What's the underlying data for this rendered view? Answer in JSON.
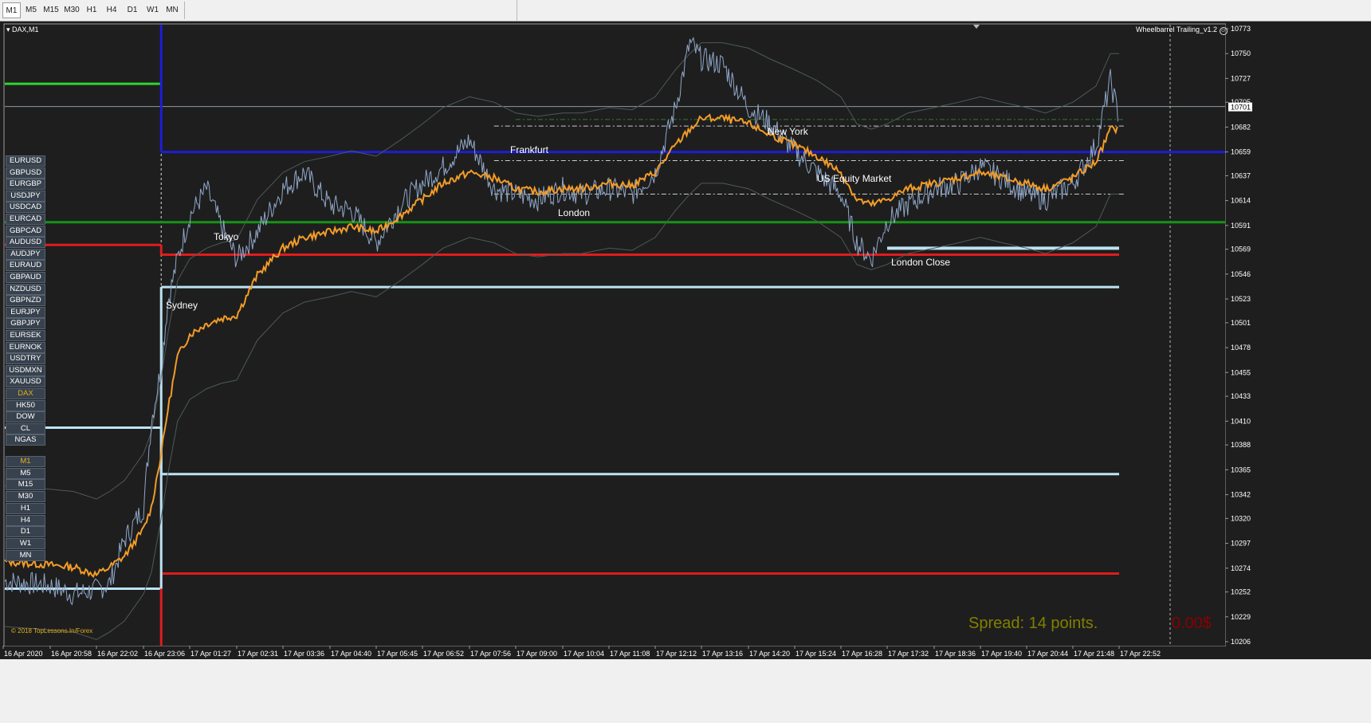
{
  "toolbar": {
    "timeframes": [
      "M1",
      "M5",
      "M15",
      "M30",
      "H1",
      "H4",
      "D1",
      "W1",
      "MN"
    ],
    "active": "M1"
  },
  "chart": {
    "symbol_label": "DAX,M1",
    "indicator_label": "Wheelbarrel Trailing_v1.2",
    "current_price": "10701",
    "copyright": "© 2018 TopLessons.In/Forex",
    "spread_text": "Spread: 14 points.",
    "pl_text": "0.00$",
    "colors": {
      "background": "#1e1e1e",
      "candles": "#8fa7c8",
      "ma_orange": "#f39c28",
      "blue_level": "#1d1dd9",
      "red_level": "#e01c1c",
      "green_level": "#149414",
      "lime_level": "#2fd42f",
      "lightblue_level": "#bde3f3",
      "spread_text": "#808000",
      "pl_text": "#8b0000"
    }
  },
  "symbol_buttons": [
    "EURUSD",
    "GBPUSD",
    "EURGBP",
    "USDJPY",
    "USDCAD",
    "EURCAD",
    "GBPCAD",
    "AUDUSD",
    "AUDJPY",
    "EURAUD",
    "GBPAUD",
    "NZDUSD",
    "GBPNZD",
    "EURJPY",
    "GBPJPY",
    "EURSEK",
    "EURNOK",
    "USDTRY",
    "USDMXN",
    "XAUUSD",
    "DAX",
    "HK50",
    "DOW",
    "CL",
    "NGAS"
  ],
  "selected_symbol": "DAX",
  "timeframe_buttons": [
    "M1",
    "M5",
    "M15",
    "M30",
    "H1",
    "H4",
    "D1",
    "W1",
    "MN"
  ],
  "selected_timeframe": "M1",
  "sessions": [
    "Sydney",
    "Tokyo",
    "Frankfurt",
    "London",
    "New York",
    "US Equity Market",
    "London Close"
  ],
  "chart_data": {
    "type": "line",
    "title": "DAX,M1",
    "price_axis_ticks": [
      "10773",
      "10750",
      "10727",
      "10705",
      "10682",
      "10659",
      "10637",
      "10614",
      "10591",
      "10569",
      "10546",
      "10523",
      "10501",
      "10478",
      "10455",
      "10433",
      "10410",
      "10388",
      "10365",
      "10342",
      "10320",
      "10297",
      "10274",
      "10252",
      "10229",
      "10206"
    ],
    "time_axis_ticks": [
      "16 Apr 2020",
      "16 Apr 20:58",
      "16 Apr 22:02",
      "16 Apr 23:06",
      "17 Apr 01:27",
      "17 Apr 02:31",
      "17 Apr 03:36",
      "17 Apr 04:40",
      "17 Apr 05:45",
      "17 Apr 06:52",
      "17 Apr 07:56",
      "17 Apr 09:00",
      "17 Apr 10:04",
      "17 Apr 11:08",
      "17 Apr 12:12",
      "17 Apr 13:16",
      "17 Apr 14:20",
      "17 Apr 15:24",
      "17 Apr 16:28",
      "17 Apr 17:32",
      "17 Apr 18:36",
      "17 Apr 19:40",
      "17 Apr 20:44",
      "17 Apr 21:48",
      "17 Apr 22:52"
    ],
    "ylim": [
      10206,
      10773
    ],
    "grid": false,
    "levels": [
      {
        "color": "blue",
        "value": 10659,
        "from": "17 Apr 00:00",
        "to": "end"
      },
      {
        "color": "red",
        "value": 10564,
        "from": "17 Apr 00:00",
        "to": "17 Apr 22:52"
      },
      {
        "color": "red",
        "value": 10573,
        "from": "start",
        "to": "17 Apr 00:00"
      },
      {
        "color": "green",
        "value": 10594,
        "from": "start",
        "to": "end"
      },
      {
        "color": "lime",
        "value": 10722,
        "from": "start",
        "to": "17 Apr 00:00"
      },
      {
        "color": "lightblue",
        "value": 10534,
        "from": "17 Apr 00:00",
        "to": "17 Apr 22:52"
      },
      {
        "color": "lightblue",
        "value": 10404,
        "from": "start",
        "to": "17 Apr 00:00"
      },
      {
        "color": "lightblue",
        "value": 10361,
        "from": "17 Apr 00:00",
        "to": "17 Apr 22:52"
      },
      {
        "color": "lightblue",
        "value": 10255,
        "from": "start",
        "to": "17 Apr 00:00"
      },
      {
        "color": "red",
        "value": 10269,
        "from": "17 Apr 00:00",
        "to": "17 Apr 22:52"
      },
      {
        "color": "lightblue",
        "value": 10570,
        "from": "17 Apr 17:32",
        "to": "17 Apr 22:52"
      }
    ],
    "price_series": {
      "name": "DAX M1",
      "points": [
        [
          "16 Apr 2020",
          10262
        ],
        [
          "16 Apr 20:58",
          10258
        ],
        [
          "16 Apr 21:30",
          10250
        ],
        [
          "16 Apr 22:02",
          10254
        ],
        [
          "16 Apr 22:20",
          10260
        ],
        [
          "16 Apr 22:40",
          10300
        ],
        [
          "16 Apr 23:06",
          10330
        ],
        [
          "16 Apr 23:30",
          10410
        ],
        [
          "17 Apr 00:00",
          10460
        ],
        [
          "17 Apr 00:20",
          10520
        ],
        [
          "17 Apr 00:50",
          10560
        ],
        [
          "17 Apr 01:27",
          10600
        ],
        [
          "17 Apr 01:50",
          10625
        ],
        [
          "17 Apr 02:10",
          10590
        ],
        [
          "17 Apr 02:31",
          10560
        ],
        [
          "17 Apr 03:00",
          10585
        ],
        [
          "17 Apr 03:36",
          10625
        ],
        [
          "17 Apr 04:05",
          10640
        ],
        [
          "17 Apr 04:40",
          10610
        ],
        [
          "17 Apr 05:10",
          10605
        ],
        [
          "17 Apr 05:45",
          10575
        ],
        [
          "17 Apr 06:20",
          10610
        ],
        [
          "17 Apr 06:52",
          10630
        ],
        [
          "17 Apr 07:20",
          10645
        ],
        [
          "17 Apr 07:56",
          10670
        ],
        [
          "17 Apr 08:30",
          10625
        ],
        [
          "17 Apr 09:00",
          10620
        ],
        [
          "17 Apr 09:30",
          10615
        ],
        [
          "17 Apr 10:04",
          10625
        ],
        [
          "17 Apr 10:30",
          10620
        ],
        [
          "17 Apr 11:08",
          10625
        ],
        [
          "17 Apr 11:40",
          10620
        ],
        [
          "17 Apr 12:12",
          10640
        ],
        [
          "17 Apr 12:40",
          10700
        ],
        [
          "17 Apr 13:00",
          10760
        ],
        [
          "17 Apr 13:16",
          10745
        ],
        [
          "17 Apr 13:45",
          10740
        ],
        [
          "17 Apr 14:20",
          10700
        ],
        [
          "17 Apr 14:50",
          10685
        ],
        [
          "17 Apr 15:24",
          10660
        ],
        [
          "17 Apr 15:55",
          10640
        ],
        [
          "17 Apr 16:28",
          10620
        ],
        [
          "17 Apr 16:50",
          10575
        ],
        [
          "17 Apr 17:10",
          10560
        ],
        [
          "17 Apr 17:32",
          10595
        ],
        [
          "17 Apr 18:00",
          10610
        ],
        [
          "17 Apr 18:36",
          10625
        ],
        [
          "17 Apr 19:10",
          10630
        ],
        [
          "17 Apr 19:40",
          10645
        ],
        [
          "17 Apr 20:10",
          10635
        ],
        [
          "17 Apr 20:44",
          10620
        ],
        [
          "17 Apr 21:10",
          10615
        ],
        [
          "17 Apr 21:48",
          10630
        ],
        [
          "17 Apr 22:20",
          10665
        ],
        [
          "17 Apr 22:40",
          10725
        ],
        [
          "17 Apr 22:52",
          10690
        ]
      ]
    },
    "ma_series": {
      "points": [
        [
          "16 Apr 2020",
          10280
        ],
        [
          "16 Apr 20:58",
          10277
        ],
        [
          "16 Apr 21:30",
          10275
        ],
        [
          "16 Apr 22:02",
          10268
        ],
        [
          "16 Apr 22:20",
          10275
        ],
        [
          "16 Apr 22:40",
          10285
        ],
        [
          "16 Apr 23:06",
          10310
        ],
        [
          "16 Apr 23:30",
          10330
        ],
        [
          "17 Apr 00:00",
          10380
        ],
        [
          "17 Apr 00:20",
          10420
        ],
        [
          "17 Apr 00:50",
          10470
        ],
        [
          "17 Apr 01:27",
          10490
        ],
        [
          "17 Apr 01:50",
          10500
        ],
        [
          "17 Apr 02:10",
          10505
        ],
        [
          "17 Apr 02:31",
          10508
        ],
        [
          "17 Apr 03:00",
          10545
        ],
        [
          "17 Apr 03:36",
          10570
        ],
        [
          "17 Apr 04:05",
          10580
        ],
        [
          "17 Apr 04:40",
          10585
        ],
        [
          "17 Apr 05:10",
          10590
        ],
        [
          "17 Apr 05:45",
          10585
        ],
        [
          "17 Apr 06:20",
          10600
        ],
        [
          "17 Apr 06:52",
          10615
        ],
        [
          "17 Apr 07:20",
          10630
        ],
        [
          "17 Apr 07:56",
          10640
        ],
        [
          "17 Apr 08:30",
          10635
        ],
        [
          "17 Apr 09:00",
          10625
        ],
        [
          "17 Apr 09:30",
          10622
        ],
        [
          "17 Apr 10:04",
          10625
        ],
        [
          "17 Apr 10:30",
          10625
        ],
        [
          "17 Apr 11:08",
          10630
        ],
        [
          "17 Apr 11:40",
          10628
        ],
        [
          "17 Apr 12:12",
          10640
        ],
        [
          "17 Apr 12:40",
          10665
        ],
        [
          "17 Apr 13:00",
          10680
        ],
        [
          "17 Apr 13:16",
          10690
        ],
        [
          "17 Apr 13:45",
          10690
        ],
        [
          "17 Apr 14:20",
          10685
        ],
        [
          "17 Apr 14:50",
          10675
        ],
        [
          "17 Apr 15:24",
          10665
        ],
        [
          "17 Apr 15:55",
          10655
        ],
        [
          "17 Apr 16:28",
          10640
        ],
        [
          "17 Apr 16:50",
          10615
        ],
        [
          "17 Apr 17:10",
          10610
        ],
        [
          "17 Apr 17:32",
          10615
        ],
        [
          "17 Apr 18:00",
          10625
        ],
        [
          "17 Apr 18:36",
          10630
        ],
        [
          "17 Apr 19:10",
          10635
        ],
        [
          "17 Apr 19:40",
          10640
        ],
        [
          "17 Apr 20:10",
          10635
        ],
        [
          "17 Apr 20:44",
          10630
        ],
        [
          "17 Apr 21:10",
          10625
        ],
        [
          "17 Apr 21:48",
          10635
        ],
        [
          "17 Apr 22:20",
          10650
        ],
        [
          "17 Apr 22:40",
          10680
        ],
        [
          "17 Apr 22:52",
          10680
        ]
      ]
    }
  }
}
